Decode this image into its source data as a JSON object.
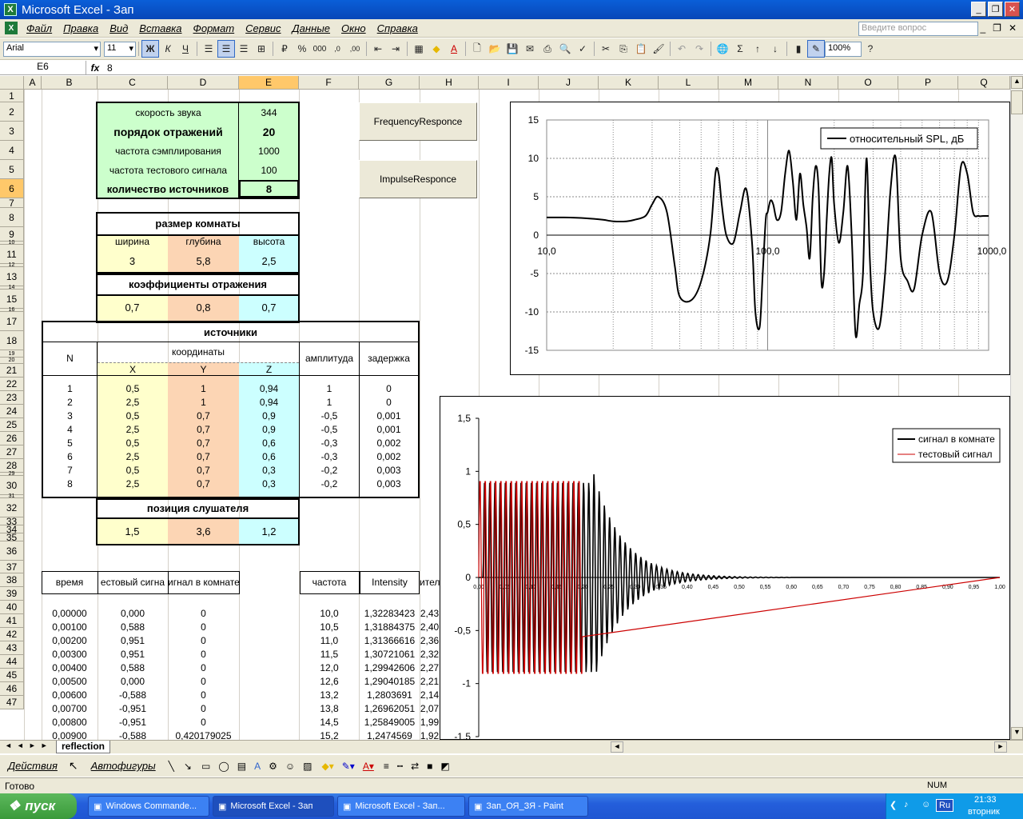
{
  "window": {
    "title": "Microsoft Excel - Зап"
  },
  "menu": [
    "Файл",
    "Правка",
    "Вид",
    "Вставка",
    "Формат",
    "Сервис",
    "Данные",
    "Окно",
    "Справка"
  ],
  "ask_placeholder": "Введите вопрос",
  "toolbar": {
    "font": "Arial",
    "size": "11",
    "bold": "Ж",
    "italic": "К",
    "underline": "Ч",
    "zoom": "100%"
  },
  "formula": {
    "cell": "E6",
    "fx": "fx",
    "value": "8"
  },
  "columns": [
    "A",
    "B",
    "C",
    "D",
    "E",
    "F",
    "G",
    "H",
    "I",
    "J",
    "K",
    "L",
    "M",
    "N",
    "O",
    "P",
    "Q"
  ],
  "rows": [
    "1",
    "2",
    "3",
    "4",
    "5",
    "6",
    "7",
    "8",
    "9",
    "10",
    "11",
    "12",
    "13",
    "14",
    "15",
    "16",
    "17",
    "18",
    "19",
    "20",
    "21",
    "22",
    "23",
    "24",
    "25",
    "26",
    "27",
    "28",
    "29",
    "30",
    "31",
    "32",
    "33",
    "34",
    "35",
    "36",
    "37",
    "38",
    "39",
    "40",
    "41",
    "42",
    "43",
    "44",
    "45",
    "46",
    "47"
  ],
  "params": {
    "sound_speed": {
      "label": "скорость звука",
      "value": "344"
    },
    "order": {
      "label": "порядок отражений",
      "value": "20"
    },
    "fs": {
      "label": "частота сэмплирования",
      "value": "1000"
    },
    "ftest": {
      "label": "частота тестового сигнала",
      "value": "100"
    },
    "nsrc": {
      "label": "количество источников",
      "value": "8"
    }
  },
  "room": {
    "title": "размер комнаты",
    "w_label": "ширина",
    "d_label": "глубина",
    "h_label": "высота",
    "w": "3",
    "d": "5,8",
    "h": "2,5"
  },
  "refl": {
    "title": "коэффициенты отражения",
    "a": "0,7",
    "b": "0,8",
    "c": "0,7"
  },
  "sources": {
    "title": "источники",
    "n": "N",
    "coords": "координаты",
    "x": "X",
    "y": "Y",
    "z": "Z",
    "amp": "амплитуда",
    "delay": "задержка",
    "rows": [
      [
        "1",
        "0,5",
        "1",
        "0,94",
        "1",
        "0"
      ],
      [
        "2",
        "2,5",
        "1",
        "0,94",
        "1",
        "0"
      ],
      [
        "3",
        "0,5",
        "0,7",
        "0,9",
        "-0,5",
        "0,001"
      ],
      [
        "4",
        "2,5",
        "0,7",
        "0,9",
        "-0,5",
        "0,001"
      ],
      [
        "5",
        "0,5",
        "0,7",
        "0,6",
        "-0,3",
        "0,002"
      ],
      [
        "6",
        "2,5",
        "0,7",
        "0,6",
        "-0,3",
        "0,002"
      ],
      [
        "7",
        "0,5",
        "0,7",
        "0,3",
        "-0,2",
        "0,003"
      ],
      [
        "8",
        "2,5",
        "0,7",
        "0,3",
        "-0,2",
        "0,003"
      ]
    ]
  },
  "listener": {
    "title": "позиция слушателя",
    "x": "1,5",
    "y": "3,6",
    "z": "1,2"
  },
  "buttons": {
    "freq": "FrequencyResponce",
    "imp": "ImpulseResponce"
  },
  "table": {
    "headers": [
      "время",
      "естовый сигна",
      "игнал в комнате",
      "частота",
      "Intensity",
      "ител"
    ],
    "rows": [
      [
        "0,00000",
        "0,000",
        "0",
        "10,0",
        "1,32283423",
        "2,43"
      ],
      [
        "0,00100",
        "0,588",
        "0",
        "10,5",
        "1,31884375",
        "2,40"
      ],
      [
        "0,00200",
        "0,951",
        "0",
        "11,0",
        "1,31366616",
        "2,36"
      ],
      [
        "0,00300",
        "0,951",
        "0",
        "11,5",
        "1,30721061",
        "2,32"
      ],
      [
        "0,00400",
        "0,588",
        "0",
        "12,0",
        "1,29942606",
        "2,27"
      ],
      [
        "0,00500",
        "0,000",
        "0",
        "12,6",
        "1,29040185",
        "2,21"
      ],
      [
        "0,00600",
        "-0,588",
        "0",
        "13,2",
        "1,2803691",
        "2,14"
      ],
      [
        "0,00700",
        "-0,951",
        "0",
        "13,8",
        "1,26962051",
        "2,07"
      ],
      [
        "0,00800",
        "-0,951",
        "0",
        "14,5",
        "1,25849005",
        "1,99"
      ],
      [
        "0,00900",
        "-0,588",
        "0,420179025",
        "15,2",
        "1,2474569",
        "1,92"
      ]
    ]
  },
  "chart_data": [
    {
      "type": "line",
      "legend": [
        "относительный SPL, дБ"
      ],
      "x_scale": "log",
      "xlim": [
        10,
        1000
      ],
      "ylim": [
        -15,
        15
      ],
      "y_ticks": [
        "15",
        "10",
        "5",
        "0",
        "-5",
        "-10",
        "-15"
      ],
      "x_tick_labels": [
        "10,0",
        "100,0",
        "1000,0"
      ],
      "series": [
        {
          "name": "относительный SPL, дБ",
          "x": [
            10,
            12,
            15,
            18,
            20,
            23,
            25,
            28,
            30,
            32,
            35,
            38,
            40,
            45,
            50,
            55,
            58,
            60,
            62,
            65,
            70,
            75,
            80,
            85,
            88,
            92,
            95,
            98,
            100,
            103,
            106,
            110,
            115,
            120,
            125,
            130,
            135,
            140,
            145,
            150,
            155,
            160,
            165,
            170,
            175,
            180,
            185,
            190,
            195,
            200,
            210,
            220,
            230,
            240,
            250,
            260,
            270,
            280,
            290,
            300,
            320,
            340,
            360,
            380,
            400,
            430,
            460,
            500,
            550,
            600,
            650,
            700,
            750,
            800,
            850,
            900,
            950,
            1000
          ],
          "y": [
            2.3,
            2.3,
            2.2,
            2,
            1.8,
            1.8,
            2,
            2.5,
            4,
            5,
            3,
            -4,
            -8,
            -8.5,
            -6,
            0,
            8,
            8,
            4,
            0,
            -1,
            3,
            6,
            -1,
            -10,
            -12,
            -5,
            2,
            3,
            4.5,
            4,
            2,
            3,
            8,
            11,
            7,
            2,
            8,
            4,
            1,
            -3,
            5,
            9,
            6,
            -6,
            -5,
            2,
            8,
            10,
            4,
            -1,
            3,
            9,
            0,
            -13,
            -9,
            -5,
            10,
            -3,
            -10,
            -12,
            -5,
            6,
            10,
            -3,
            -6,
            -7,
            0,
            3,
            -5,
            -6,
            0,
            9,
            8,
            3,
            2.5,
            2.5,
            2.5
          ]
        }
      ]
    },
    {
      "type": "line",
      "legend": [
        "сигнал в комнате",
        "тестовый сигнал"
      ],
      "xlim": [
        0,
        1
      ],
      "ylim": [
        -1.5,
        1.5
      ],
      "y_ticks": [
        "1,5",
        "1",
        "0,5",
        "0",
        "-0,5",
        "-1",
        "-1,5"
      ],
      "x_tick_labels": [
        "0,00",
        "0,05",
        "0,10",
        "0,15",
        "0,20",
        "0,25",
        "0,30",
        "0,35",
        "0,40",
        "0,45",
        "0,50",
        "0,55",
        "0,60",
        "0,65",
        "0,70",
        "0,75",
        "0,80",
        "0,85",
        "0,90",
        "0,95",
        "1,00"
      ],
      "series": [
        {
          "name": "сигнал в комнате",
          "color": "#000000",
          "x": [
            0,
            0.21,
            0.22,
            0.3,
            0.4,
            0.55,
            1.0
          ],
          "y": [
            0,
            1.0,
            -1.0,
            0.2,
            0.02,
            0,
            0
          ]
        },
        {
          "name": "тестовый сигнал",
          "color": "#cc0000",
          "x": [
            0,
            0.2,
            1.0
          ],
          "y": [
            0,
            0.95,
            0
          ]
        }
      ]
    }
  ],
  "sheet_tab": "reflection",
  "draw": {
    "actions": "Действия",
    "autoshapes": "Автофигуры"
  },
  "status": {
    "ready": "Готово",
    "num": "NUM"
  },
  "taskbar": {
    "start": "пуск",
    "tasks": [
      "Windows Commande...",
      "Microsoft Excel - Зап",
      "Microsoft Excel - Зап...",
      "Зап_ОЯ_ЗЯ - Paint"
    ],
    "lang": "Ru",
    "time": "21:33",
    "day": "вторник"
  }
}
